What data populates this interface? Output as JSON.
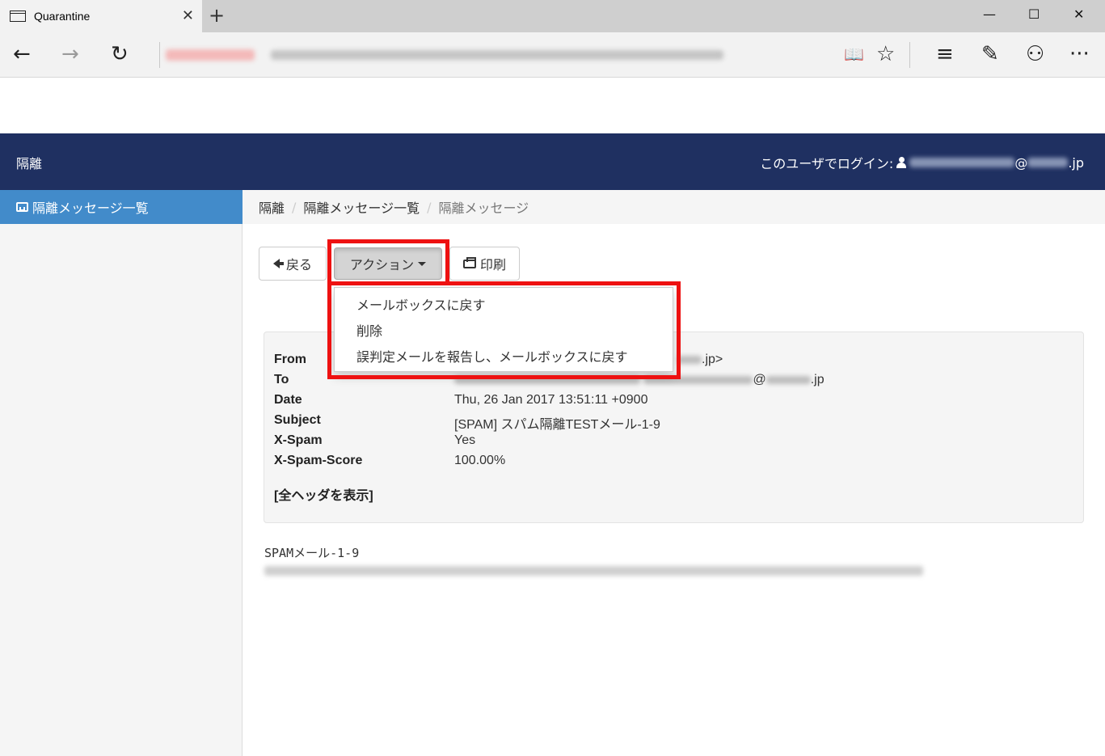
{
  "browser": {
    "tab_title": "Quarantine",
    "tab_close": "✕",
    "new_tab": "+",
    "minimize": "—",
    "maximize": "☐",
    "close": "✕",
    "back_glyph": "←",
    "forward_glyph": "→",
    "refresh_glyph": "↻",
    "reading_glyph": "📖",
    "favorite_glyph": "☆",
    "hub_glyph": "≡",
    "note_glyph": "✎",
    "share_glyph": "⚇",
    "more_glyph": "···"
  },
  "navbar": {
    "brand": "隔離",
    "login_label": "このユーザでログイン:",
    "login_at": "@",
    "login_suffix": ".jp"
  },
  "sidebar": {
    "items": [
      {
        "label": "隔離メッセージ一覧",
        "icon": "inbox-icon"
      }
    ]
  },
  "breadcrumb": {
    "items": [
      "隔離",
      "隔離メッセージ一覧",
      "隔離メッセージ"
    ],
    "separator": "/"
  },
  "actions": {
    "back_label": "戻る",
    "action_label": "アクション",
    "print_label": "印刷"
  },
  "dropdown": {
    "items": [
      "メールボックスに戻す",
      "削除",
      "誤判定メールを報告し、メールボックスに戻す"
    ]
  },
  "headers": {
    "from_label": "From",
    "from_value_suffix": ".jp>",
    "to_label": "To",
    "to_at": "@",
    "to_suffix": ".jp",
    "date_label": "Date",
    "date_value": "Thu, 26 Jan 2017 13:51:11 +0900",
    "subject_label": "Subject",
    "subject_value": "[SPAM] スパム隔離TESTメール-1-9",
    "xspam_label": "X-Spam",
    "xspam_value": "Yes",
    "xscore_label": "X-Spam-Score",
    "xscore_value": "100.00%",
    "show_all": "[全ヘッダを表示]"
  },
  "message": {
    "body_first_line": "SPAMメール-1-9"
  },
  "colors": {
    "navbar": "#1f3061",
    "sidebar_active": "#428bca",
    "highlight": "#ee1111"
  }
}
